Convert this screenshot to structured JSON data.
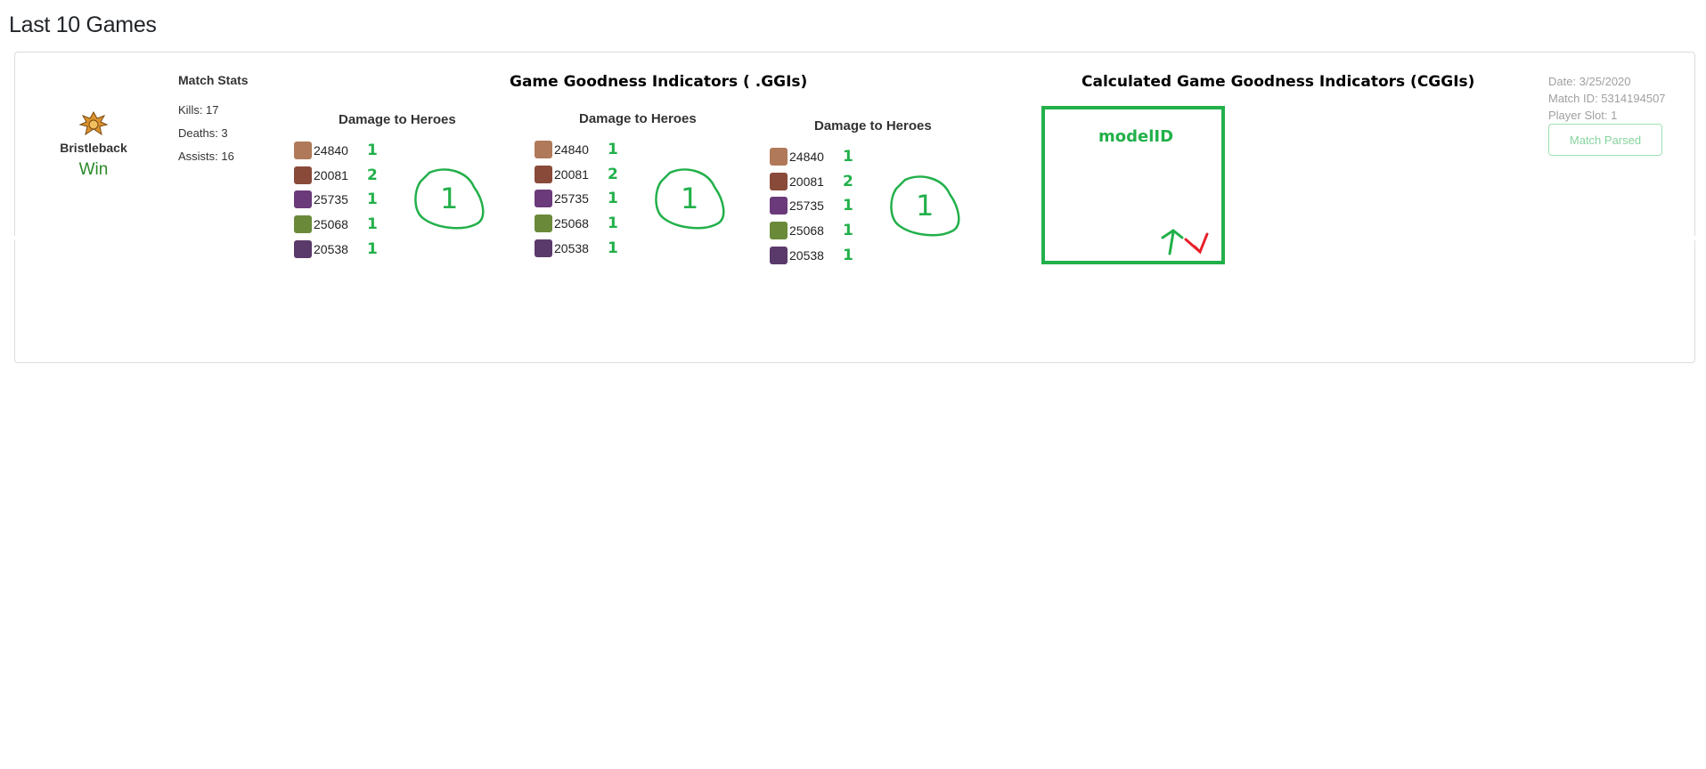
{
  "page": {
    "title": "Last 10 Games"
  },
  "match": {
    "hero": {
      "name": "Bristleback",
      "icon": "bristleback-hero-icon",
      "result": "Win"
    },
    "stats": {
      "title": "Match Stats",
      "kills": "Kills: 17",
      "deaths": "Deaths: 3",
      "assists": "Assists: 16"
    },
    "ggi_title": "Game Goodness Indicators ( .GGIs)",
    "cggi_title": "Calculated Game Goodness Indicators (CGGIs)",
    "damage_blocks": [
      {
        "title": "Damage to Heroes",
        "rows": [
          {
            "value": "24840",
            "mark": "1",
            "hero_color": "#b07a5a"
          },
          {
            "value": "20081",
            "mark": "2",
            "hero_color": "#8a4a3a"
          },
          {
            "value": "25735",
            "mark": "1",
            "hero_color": "#6a3a7a"
          },
          {
            "value": "25068",
            "mark": "1",
            "hero_color": "#6a8a3a"
          },
          {
            "value": "20538",
            "mark": "1",
            "hero_color": "#5a3a6a"
          }
        ],
        "circle_mark": "1"
      },
      {
        "title": "Damage to Heroes",
        "rows": [
          {
            "value": "24840",
            "mark": "1",
            "hero_color": "#b07a5a"
          },
          {
            "value": "20081",
            "mark": "2",
            "hero_color": "#8a4a3a"
          },
          {
            "value": "25735",
            "mark": "1",
            "hero_color": "#6a3a7a"
          },
          {
            "value": "25068",
            "mark": "1",
            "hero_color": "#6a8a3a"
          },
          {
            "value": "20538",
            "mark": "1",
            "hero_color": "#5a3a6a"
          }
        ],
        "circle_mark": "1"
      },
      {
        "title": "Damage to Heroes",
        "rows": [
          {
            "value": "24840",
            "mark": "1",
            "hero_color": "#b07a5a"
          },
          {
            "value": "20081",
            "mark": "2",
            "hero_color": "#8a4a3a"
          },
          {
            "value": "25735",
            "mark": "1",
            "hero_color": "#6a3a7a"
          },
          {
            "value": "25068",
            "mark": "1",
            "hero_color": "#6a8a3a"
          },
          {
            "value": "20538",
            "mark": "1",
            "hero_color": "#5a3a6a"
          }
        ],
        "circle_mark": "1"
      }
    ],
    "model": {
      "label": "modelID",
      "thumbs_up_icon": "thumbs-up-icon",
      "thumbs_down_icon": "thumbs-down-icon"
    },
    "meta": {
      "date": "Date: 3/25/2020",
      "match_id": "Match ID: 5314194507",
      "player_slot": "Player Slot: 1",
      "parsed_label": "Match Parsed"
    }
  },
  "colors": {
    "accent_green": "#22b04a",
    "thumbs_down_red": "#e8202a",
    "win_green": "#2a8a2a"
  }
}
